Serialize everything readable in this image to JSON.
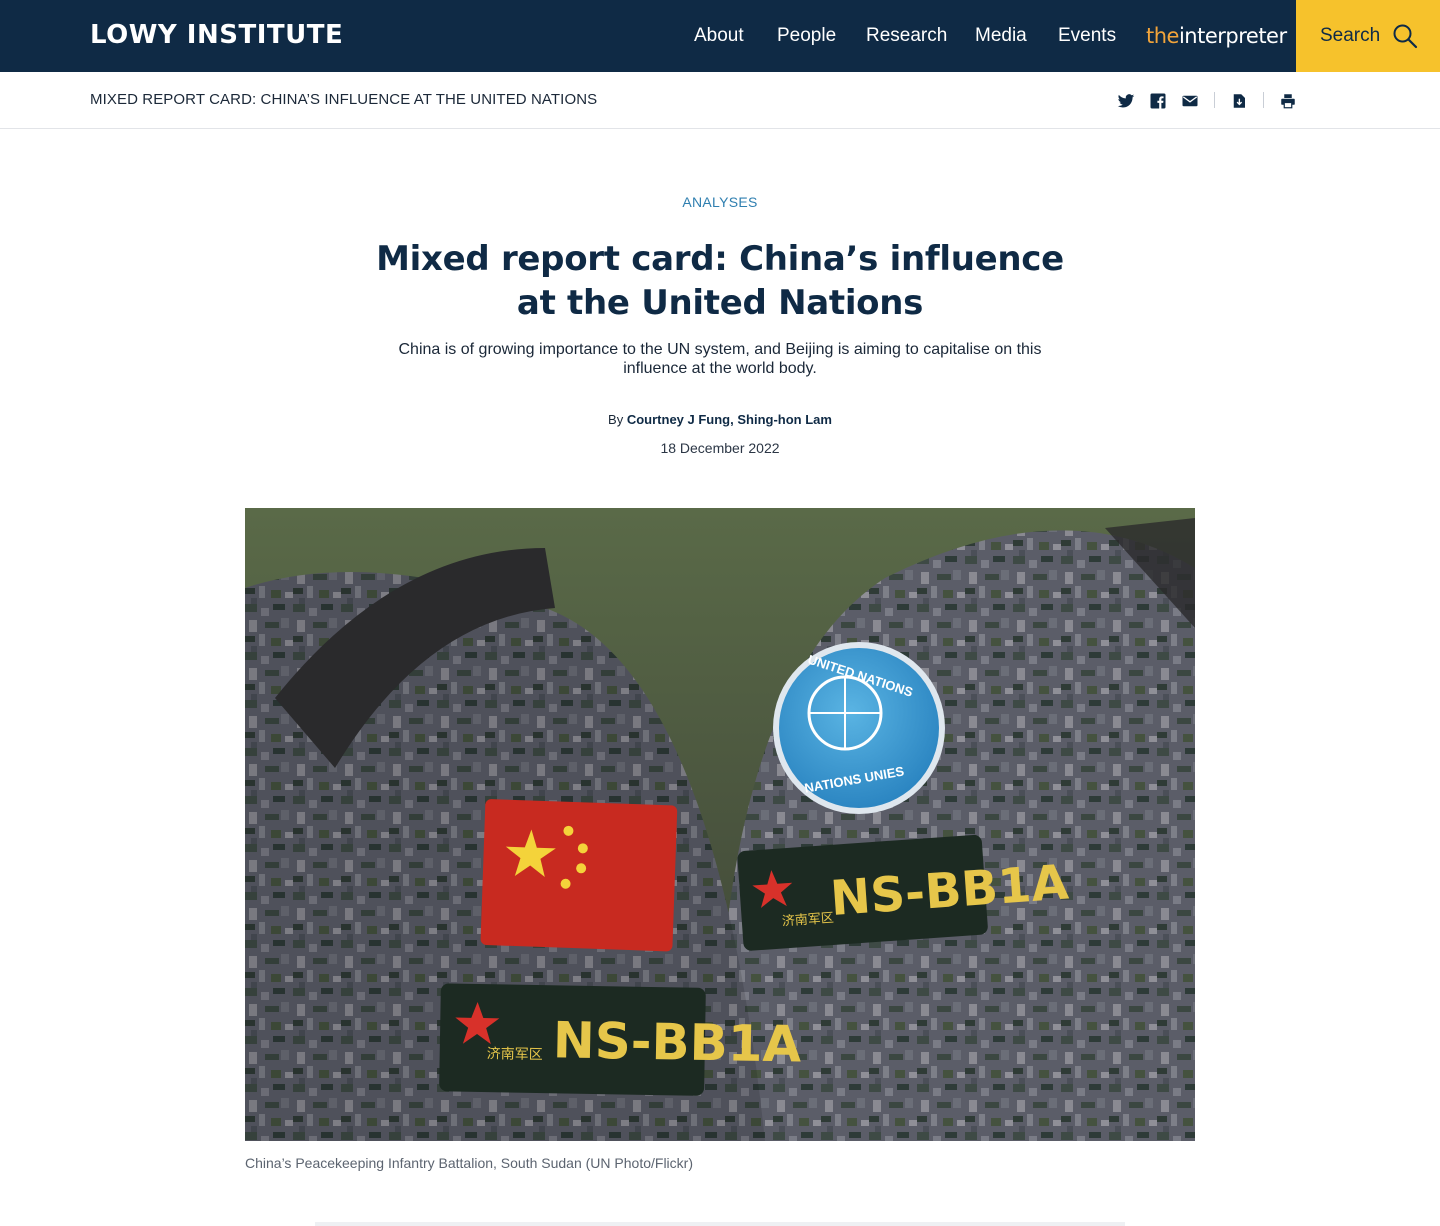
{
  "header": {
    "logo": "LOWY INSTITUTE",
    "nav": [
      "About",
      "People",
      "Research",
      "Media",
      "Events"
    ],
    "interpreter": {
      "prefix": "the",
      "suffix": "interpreter"
    },
    "search_label": "Search",
    "colors": {
      "navy": "#0f2a45",
      "search_bg": "#f6c22c",
      "interpreter_accent": "#f2a43a"
    }
  },
  "subbar": {
    "title": "MIXED REPORT CARD: CHINA’S INFLUENCE AT THE UNITED NATIONS",
    "icons": [
      "twitter-icon",
      "facebook-icon",
      "email-icon",
      "download-icon",
      "print-icon"
    ]
  },
  "article": {
    "kicker": "ANALYSES",
    "title": "Mixed report card: China’s influence at the United Nations",
    "standfirst": "China is of growing importance to the UN system, and Beijing is aiming to capitalise on this influence at the world body.",
    "by": "By",
    "authors": "Courtney J Fung, Shing-hon Lam",
    "date": "18 December 2022",
    "image": {
      "patch_un_top": "UNITED NATIONS",
      "patch_un_bottom": "NATIONS UNIES",
      "patch_unit": "NS-BB1A",
      "patch_cn": "济南军区"
    },
    "caption": "China’s Peacekeeping Infantry Battalion, South Sudan (UN Photo/Flickr)"
  }
}
